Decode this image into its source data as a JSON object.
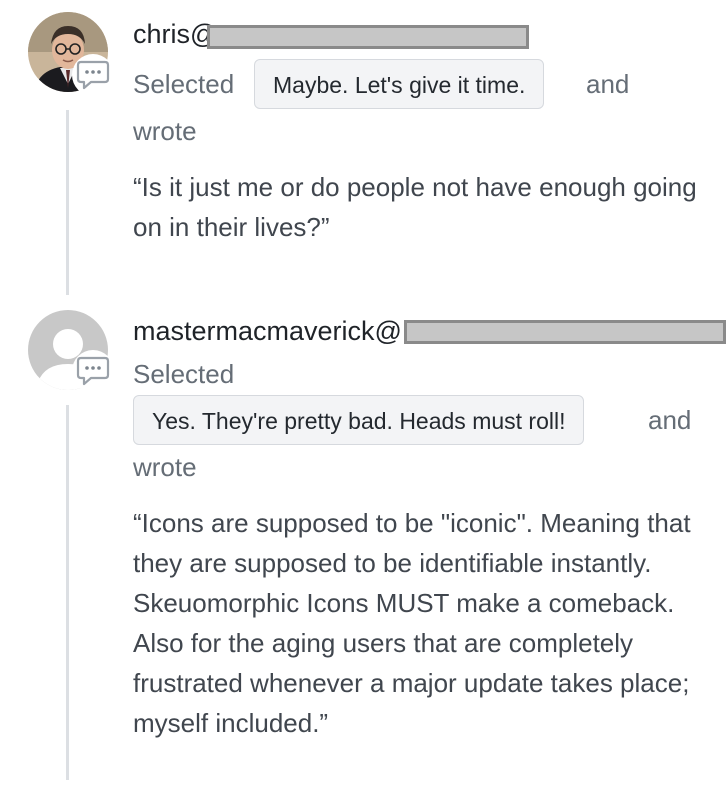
{
  "comments": [
    {
      "username": "chris@",
      "selected_label": "Selected",
      "option": "Maybe. Let's give it time.",
      "and_label": "and",
      "wrote_label": "wrote",
      "quote": "“Is it just me or do people not have enough going on in their lives?”",
      "avatar_icon": "user-photo-avatar",
      "badge_icon": "comment-bubble-icon"
    },
    {
      "username": "mastermacmaverick@",
      "selected_label": "Selected",
      "option": "Yes. They're pretty bad. Heads must roll!",
      "and_label": "and",
      "wrote_label": "wrote",
      "quote": "“Icons are supposed to be \"iconic\". Meaning that they are supposed to be identifiable instantly. Skeuomorphic Icons MUST make a comeback. Also for the aging users that are completely frustrated whenever a major update takes place; myself included.”",
      "avatar_icon": "default-user-avatar",
      "badge_icon": "comment-bubble-icon"
    }
  ],
  "colors": {
    "thread_line": "#dcdfe3",
    "muted_text": "#656d76",
    "pill_background": "#f3f4f6",
    "redaction_fill": "#c6c6c6"
  }
}
